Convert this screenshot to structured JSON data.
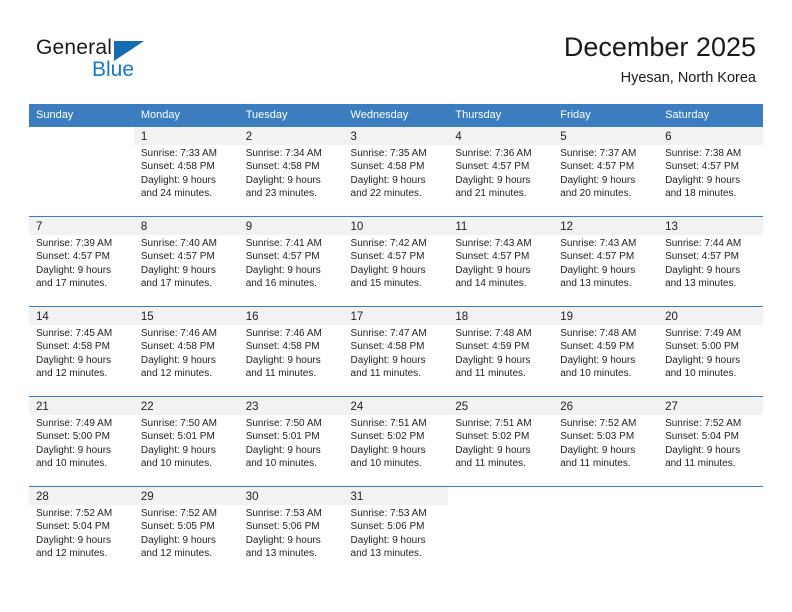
{
  "brand": {
    "word_one": "General",
    "word_two": "Blue",
    "triangle_icon": "triangle-icon",
    "accent_dark": "#156cb4",
    "accent_light": "#1578c8"
  },
  "header": {
    "title": "December 2025",
    "subtitle": "Hyesan, North Korea"
  },
  "theme": {
    "header_row_bg": "#3b7dbf",
    "band_bg": "#f2f2f2",
    "text": "#222222"
  },
  "calendar": {
    "weekdays": [
      "Sunday",
      "Monday",
      "Tuesday",
      "Wednesday",
      "Thursday",
      "Friday",
      "Saturday"
    ],
    "weeks": [
      [
        {
          "day": "",
          "sunrise": "",
          "sunset": "",
          "daylight_1": "",
          "daylight_2": "",
          "empty": true
        },
        {
          "day": "1",
          "sunrise": "Sunrise: 7:33 AM",
          "sunset": "Sunset: 4:58 PM",
          "daylight_1": "Daylight: 9 hours",
          "daylight_2": "and 24 minutes.",
          "empty": false
        },
        {
          "day": "2",
          "sunrise": "Sunrise: 7:34 AM",
          "sunset": "Sunset: 4:58 PM",
          "daylight_1": "Daylight: 9 hours",
          "daylight_2": "and 23 minutes.",
          "empty": false
        },
        {
          "day": "3",
          "sunrise": "Sunrise: 7:35 AM",
          "sunset": "Sunset: 4:58 PM",
          "daylight_1": "Daylight: 9 hours",
          "daylight_2": "and 22 minutes.",
          "empty": false
        },
        {
          "day": "4",
          "sunrise": "Sunrise: 7:36 AM",
          "sunset": "Sunset: 4:57 PM",
          "daylight_1": "Daylight: 9 hours",
          "daylight_2": "and 21 minutes.",
          "empty": false
        },
        {
          "day": "5",
          "sunrise": "Sunrise: 7:37 AM",
          "sunset": "Sunset: 4:57 PM",
          "daylight_1": "Daylight: 9 hours",
          "daylight_2": "and 20 minutes.",
          "empty": false
        },
        {
          "day": "6",
          "sunrise": "Sunrise: 7:38 AM",
          "sunset": "Sunset: 4:57 PM",
          "daylight_1": "Daylight: 9 hours",
          "daylight_2": "and 18 minutes.",
          "empty": false
        }
      ],
      [
        {
          "day": "7",
          "sunrise": "Sunrise: 7:39 AM",
          "sunset": "Sunset: 4:57 PM",
          "daylight_1": "Daylight: 9 hours",
          "daylight_2": "and 17 minutes.",
          "empty": false
        },
        {
          "day": "8",
          "sunrise": "Sunrise: 7:40 AM",
          "sunset": "Sunset: 4:57 PM",
          "daylight_1": "Daylight: 9 hours",
          "daylight_2": "and 17 minutes.",
          "empty": false
        },
        {
          "day": "9",
          "sunrise": "Sunrise: 7:41 AM",
          "sunset": "Sunset: 4:57 PM",
          "daylight_1": "Daylight: 9 hours",
          "daylight_2": "and 16 minutes.",
          "empty": false
        },
        {
          "day": "10",
          "sunrise": "Sunrise: 7:42 AM",
          "sunset": "Sunset: 4:57 PM",
          "daylight_1": "Daylight: 9 hours",
          "daylight_2": "and 15 minutes.",
          "empty": false
        },
        {
          "day": "11",
          "sunrise": "Sunrise: 7:43 AM",
          "sunset": "Sunset: 4:57 PM",
          "daylight_1": "Daylight: 9 hours",
          "daylight_2": "and 14 minutes.",
          "empty": false
        },
        {
          "day": "12",
          "sunrise": "Sunrise: 7:43 AM",
          "sunset": "Sunset: 4:57 PM",
          "daylight_1": "Daylight: 9 hours",
          "daylight_2": "and 13 minutes.",
          "empty": false
        },
        {
          "day": "13",
          "sunrise": "Sunrise: 7:44 AM",
          "sunset": "Sunset: 4:57 PM",
          "daylight_1": "Daylight: 9 hours",
          "daylight_2": "and 13 minutes.",
          "empty": false
        }
      ],
      [
        {
          "day": "14",
          "sunrise": "Sunrise: 7:45 AM",
          "sunset": "Sunset: 4:58 PM",
          "daylight_1": "Daylight: 9 hours",
          "daylight_2": "and 12 minutes.",
          "empty": false
        },
        {
          "day": "15",
          "sunrise": "Sunrise: 7:46 AM",
          "sunset": "Sunset: 4:58 PM",
          "daylight_1": "Daylight: 9 hours",
          "daylight_2": "and 12 minutes.",
          "empty": false
        },
        {
          "day": "16",
          "sunrise": "Sunrise: 7:46 AM",
          "sunset": "Sunset: 4:58 PM",
          "daylight_1": "Daylight: 9 hours",
          "daylight_2": "and 11 minutes.",
          "empty": false
        },
        {
          "day": "17",
          "sunrise": "Sunrise: 7:47 AM",
          "sunset": "Sunset: 4:58 PM",
          "daylight_1": "Daylight: 9 hours",
          "daylight_2": "and 11 minutes.",
          "empty": false
        },
        {
          "day": "18",
          "sunrise": "Sunrise: 7:48 AM",
          "sunset": "Sunset: 4:59 PM",
          "daylight_1": "Daylight: 9 hours",
          "daylight_2": "and 11 minutes.",
          "empty": false
        },
        {
          "day": "19",
          "sunrise": "Sunrise: 7:48 AM",
          "sunset": "Sunset: 4:59 PM",
          "daylight_1": "Daylight: 9 hours",
          "daylight_2": "and 10 minutes.",
          "empty": false
        },
        {
          "day": "20",
          "sunrise": "Sunrise: 7:49 AM",
          "sunset": "Sunset: 5:00 PM",
          "daylight_1": "Daylight: 9 hours",
          "daylight_2": "and 10 minutes.",
          "empty": false
        }
      ],
      [
        {
          "day": "21",
          "sunrise": "Sunrise: 7:49 AM",
          "sunset": "Sunset: 5:00 PM",
          "daylight_1": "Daylight: 9 hours",
          "daylight_2": "and 10 minutes.",
          "empty": false
        },
        {
          "day": "22",
          "sunrise": "Sunrise: 7:50 AM",
          "sunset": "Sunset: 5:01 PM",
          "daylight_1": "Daylight: 9 hours",
          "daylight_2": "and 10 minutes.",
          "empty": false
        },
        {
          "day": "23",
          "sunrise": "Sunrise: 7:50 AM",
          "sunset": "Sunset: 5:01 PM",
          "daylight_1": "Daylight: 9 hours",
          "daylight_2": "and 10 minutes.",
          "empty": false
        },
        {
          "day": "24",
          "sunrise": "Sunrise: 7:51 AM",
          "sunset": "Sunset: 5:02 PM",
          "daylight_1": "Daylight: 9 hours",
          "daylight_2": "and 10 minutes.",
          "empty": false
        },
        {
          "day": "25",
          "sunrise": "Sunrise: 7:51 AM",
          "sunset": "Sunset: 5:02 PM",
          "daylight_1": "Daylight: 9 hours",
          "daylight_2": "and 11 minutes.",
          "empty": false
        },
        {
          "day": "26",
          "sunrise": "Sunrise: 7:52 AM",
          "sunset": "Sunset: 5:03 PM",
          "daylight_1": "Daylight: 9 hours",
          "daylight_2": "and 11 minutes.",
          "empty": false
        },
        {
          "day": "27",
          "sunrise": "Sunrise: 7:52 AM",
          "sunset": "Sunset: 5:04 PM",
          "daylight_1": "Daylight: 9 hours",
          "daylight_2": "and 11 minutes.",
          "empty": false
        }
      ],
      [
        {
          "day": "28",
          "sunrise": "Sunrise: 7:52 AM",
          "sunset": "Sunset: 5:04 PM",
          "daylight_1": "Daylight: 9 hours",
          "daylight_2": "and 12 minutes.",
          "empty": false
        },
        {
          "day": "29",
          "sunrise": "Sunrise: 7:52 AM",
          "sunset": "Sunset: 5:05 PM",
          "daylight_1": "Daylight: 9 hours",
          "daylight_2": "and 12 minutes.",
          "empty": false
        },
        {
          "day": "30",
          "sunrise": "Sunrise: 7:53 AM",
          "sunset": "Sunset: 5:06 PM",
          "daylight_1": "Daylight: 9 hours",
          "daylight_2": "and 13 minutes.",
          "empty": false
        },
        {
          "day": "31",
          "sunrise": "Sunrise: 7:53 AM",
          "sunset": "Sunset: 5:06 PM",
          "daylight_1": "Daylight: 9 hours",
          "daylight_2": "and 13 minutes.",
          "empty": false
        },
        {
          "day": "",
          "sunrise": "",
          "sunset": "",
          "daylight_1": "",
          "daylight_2": "",
          "empty": true
        },
        {
          "day": "",
          "sunrise": "",
          "sunset": "",
          "daylight_1": "",
          "daylight_2": "",
          "empty": true
        },
        {
          "day": "",
          "sunrise": "",
          "sunset": "",
          "daylight_1": "",
          "daylight_2": "",
          "empty": true
        }
      ]
    ]
  }
}
